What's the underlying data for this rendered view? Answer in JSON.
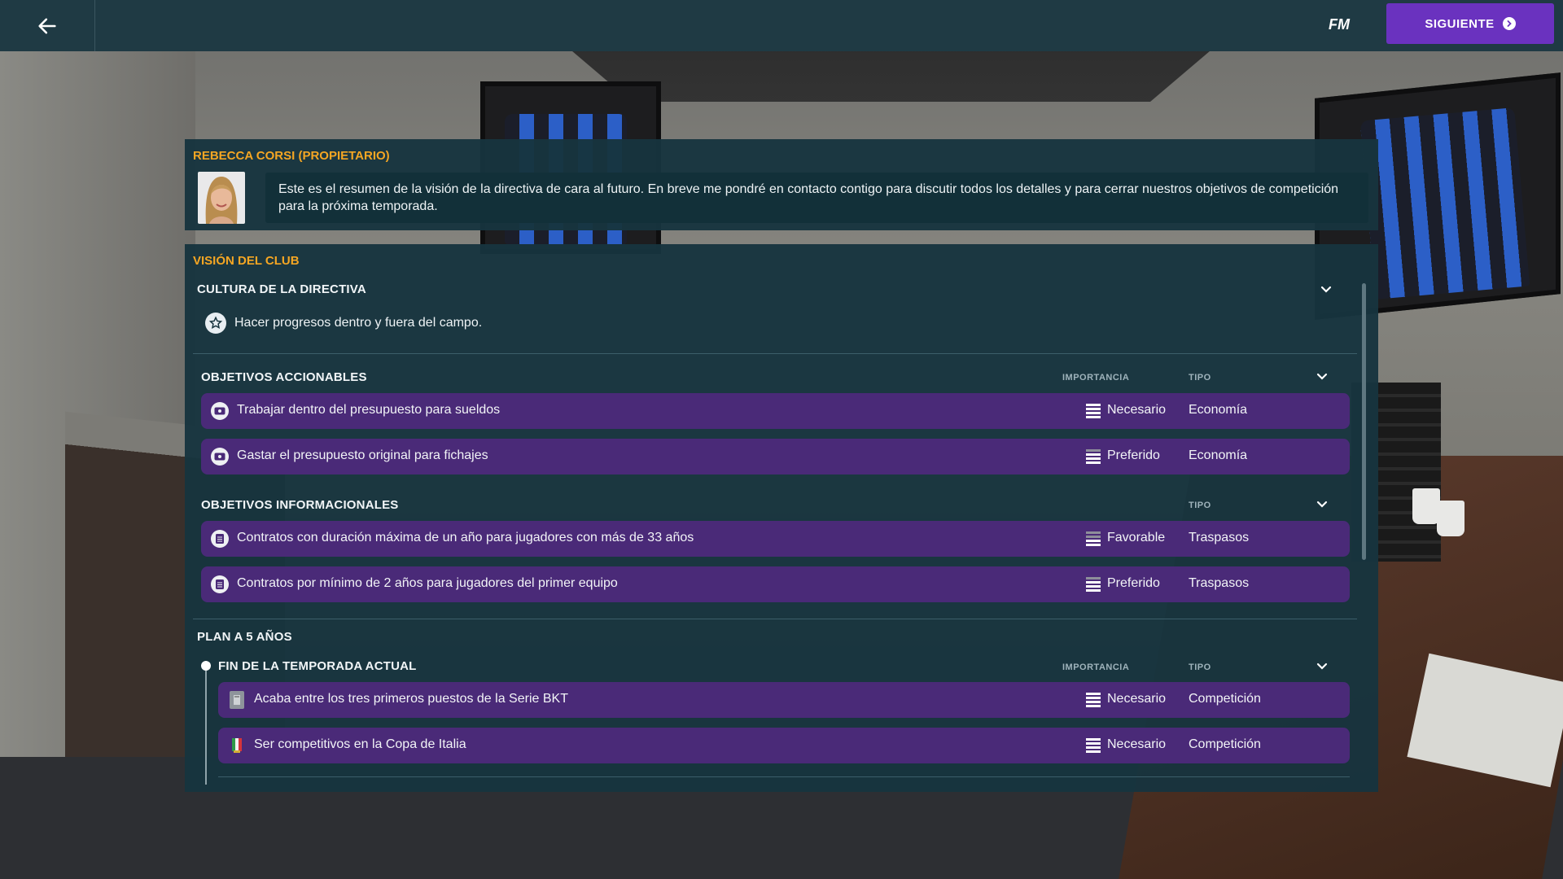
{
  "topbar": {
    "back_icon": "arrow-left-icon",
    "logo": "FM",
    "next_label": "SIGUIENTE",
    "next_icon": "chevron-circle-right-icon",
    "next_color": "#6a32bf"
  },
  "owner": {
    "name": "REBECCA CORSI (PROPIETARIO)",
    "message": "Este es el resumen de la visión de la directiva de cara al futuro. En breve me pondré en contacto contigo para discutir todos los detalles y para cerrar nuestros objetivos de competición para la próxima temporada."
  },
  "vision": {
    "title": "VISIÓN DEL CLUB",
    "culture": {
      "title": "CULTURA DE LA DIRECTIVA",
      "item": "Hacer progresos dentro y fuera del campo."
    },
    "actionable": {
      "title": "OBJETIVOS ACCIONABLES",
      "col_importance": "IMPORTANCIA",
      "col_type": "TIPO",
      "rows": [
        {
          "text": "Trabajar dentro del presupuesto para sueldos",
          "importance": "Necesario",
          "type": "Economía"
        },
        {
          "text": "Gastar el presupuesto original para fichajes",
          "importance": "Preferido",
          "type": "Economía"
        }
      ]
    },
    "informational": {
      "title": "OBJETIVOS INFORMACIONALES",
      "col_type": "TIPO",
      "rows": [
        {
          "text": "Contratos con duración máxima de un año para jugadores con más de 33 años",
          "importance": "Favorable",
          "type": "Traspasos"
        },
        {
          "text": "Contratos por mínimo de 2 años para jugadores del primer equipo",
          "importance": "Preferido",
          "type": "Traspasos"
        }
      ]
    },
    "plan": {
      "title": "PLAN A 5 AÑOS",
      "season": {
        "title": "FIN DE LA TEMPORADA ACTUAL",
        "col_importance": "IMPORTANCIA",
        "col_type": "TIPO",
        "rows": [
          {
            "text": "Acaba entre los tres primeros puestos de la Serie BKT",
            "importance": "Necesario",
            "type": "Competición"
          },
          {
            "text": "Ser competitivos en la Copa de Italia",
            "importance": "Necesario",
            "type": "Competición"
          }
        ]
      }
    }
  },
  "colors": {
    "accent_orange": "#f5a623",
    "row_purple": "#4a2a78",
    "panel_bg": "#17343e"
  }
}
